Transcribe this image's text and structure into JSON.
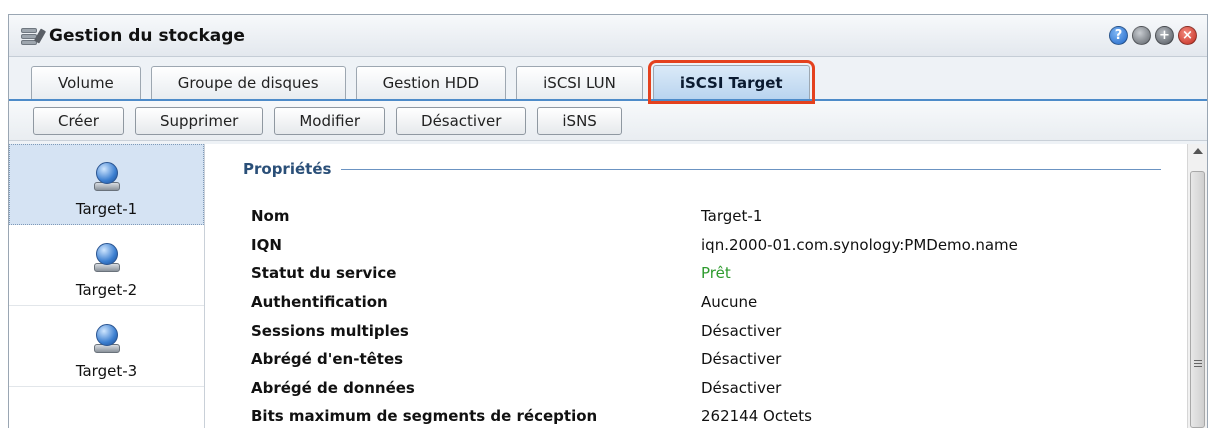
{
  "window": {
    "title": "Gestion du stockage",
    "buttons": [
      {
        "name": "help",
        "glyph": "?"
      },
      {
        "name": "minimize",
        "glyph": ""
      },
      {
        "name": "maximize",
        "glyph": "+"
      },
      {
        "name": "close",
        "glyph": "×"
      }
    ]
  },
  "tabs": [
    {
      "label": "Volume"
    },
    {
      "label": "Groupe de disques"
    },
    {
      "label": "Gestion HDD"
    },
    {
      "label": "iSCSI LUN"
    },
    {
      "label": "iSCSI Target",
      "active": true
    }
  ],
  "toolbar": {
    "create": "Créer",
    "delete": "Supprimer",
    "edit": "Modifier",
    "disable": "Désactiver",
    "isns": "iSNS"
  },
  "targets": [
    {
      "label": "Target-1",
      "selected": true
    },
    {
      "label": "Target-2"
    },
    {
      "label": "Target-3"
    }
  ],
  "properties": {
    "title": "Propriétés",
    "rows": [
      {
        "key": "Nom",
        "value": "Target-1"
      },
      {
        "key": "IQN",
        "value": "iqn.2000-01.com.synology:PMDemo.name"
      },
      {
        "key": "Statut du service",
        "value": "Prêt"
      },
      {
        "key": "Authentification",
        "value": "Aucune"
      },
      {
        "key": "Sessions multiples",
        "value": "Désactiver"
      },
      {
        "key": "Abrégé d'en-têtes",
        "value": "Désactiver"
      },
      {
        "key": "Abrégé de données",
        "value": "Désactiver"
      },
      {
        "key": "Bits maximum de segments de réception",
        "value": "262144 Octets"
      }
    ]
  },
  "colors": {
    "highlight_outline": "#e4411e",
    "tab_underline": "#4d8bc9",
    "status_ready": "#2e9b2e"
  }
}
